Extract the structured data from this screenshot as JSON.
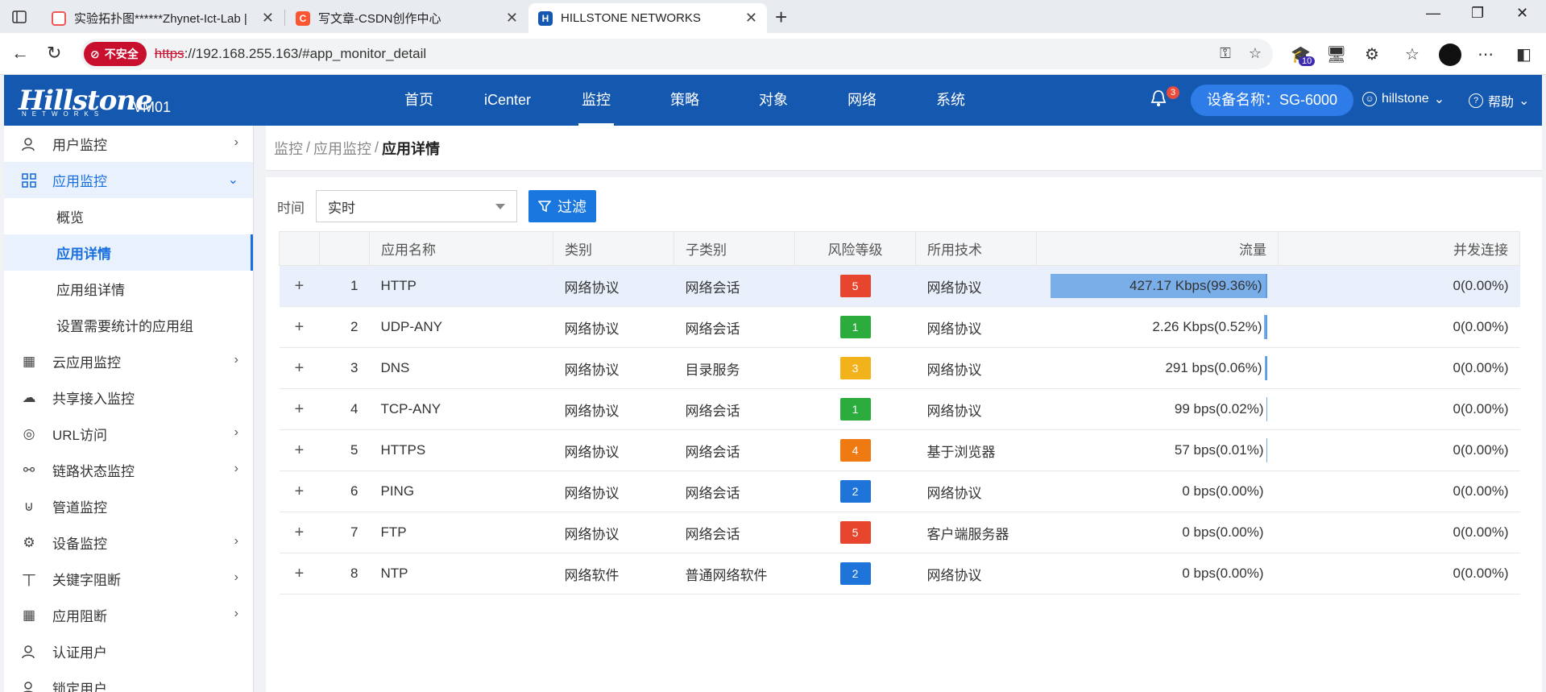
{
  "browser": {
    "tabs": [
      {
        "title": "实验拓扑图******Zhynet-Ict-Lab |",
        "icon": "chrome-icon"
      },
      {
        "title": "写文章-CSDN创作中心",
        "icon": "csdn-icon",
        "icon_letter": "C"
      },
      {
        "title": "HILLSTONE NETWORKS",
        "icon": "hillstone-icon",
        "icon_letter": "H"
      }
    ],
    "insecure_label": "不安全",
    "url_scheme": "https",
    "url_rest": "://192.168.255.163/#app_monitor_detail",
    "ext_badge": "10"
  },
  "header": {
    "logo": "Hillstone",
    "logo_sub": "NETWORKS",
    "device_id": "VM01",
    "nav": [
      "首页",
      "iCenter",
      "监控",
      "策略",
      "对象",
      "网络",
      "系统"
    ],
    "active_nav": "监控",
    "bell_count": "3",
    "device_name": "设备名称：SG-6000",
    "user": "hillstone",
    "help": "帮助"
  },
  "sidebar": {
    "user_monitor": "用户监控",
    "app_monitor": "应用监控",
    "sub": [
      "概览",
      "应用详情",
      "应用组详情",
      "设置需要统计的应用组"
    ],
    "cloud_app": "云应用监控",
    "shared_access": "共享接入监控",
    "url_access": "URL访问",
    "link_status": "链路状态监控",
    "tunnel": "管道监控",
    "device_monitor": "设备监控",
    "keyword_block": "关键字阻断",
    "app_block": "应用阻断",
    "auth_user": "认证用户",
    "bind_user": "锁定用户"
  },
  "breadcrumb": {
    "p1": "监控",
    "p2": "应用监控",
    "current": "应用详情"
  },
  "filter": {
    "time_label": "时间",
    "time_value": "实时",
    "button": "过滤"
  },
  "table": {
    "headers": {
      "name": "应用名称",
      "category": "类别",
      "subcategory": "子类别",
      "risk": "风险等级",
      "tech": "所用技术",
      "flow": "流量",
      "concurrent": "并发连接"
    },
    "rows": [
      {
        "idx": "1",
        "name": "HTTP",
        "category": "网络协议",
        "subcategory": "网络会话",
        "risk": "5",
        "risk_color": "#e8452e",
        "tech": "网络协议",
        "flow": "427.17 Kbps(99.36%)",
        "flow_pct": 99.36,
        "concurrent": "0(0.00%)"
      },
      {
        "idx": "2",
        "name": "UDP-ANY",
        "category": "网络协议",
        "subcategory": "网络会话",
        "risk": "1",
        "risk_color": "#2bac3c",
        "tech": "网络协议",
        "flow": "2.26 Kbps(0.52%)",
        "flow_pct": 0.52,
        "concurrent": "0(0.00%)"
      },
      {
        "idx": "3",
        "name": "DNS",
        "category": "网络协议",
        "subcategory": "目录服务",
        "risk": "3",
        "risk_color": "#f2b21c",
        "tech": "网络协议",
        "flow": "291 bps(0.06%)",
        "flow_pct": 0.06,
        "concurrent": "0(0.00%)"
      },
      {
        "idx": "4",
        "name": "TCP-ANY",
        "category": "网络协议",
        "subcategory": "网络会话",
        "risk": "1",
        "risk_color": "#2bac3c",
        "tech": "网络协议",
        "flow": "99 bps(0.02%)",
        "flow_pct": 0.02,
        "concurrent": "0(0.00%)"
      },
      {
        "idx": "5",
        "name": "HTTPS",
        "category": "网络协议",
        "subcategory": "网络会话",
        "risk": "4",
        "risk_color": "#f07a12",
        "tech": "基于浏览器",
        "flow": "57 bps(0.01%)",
        "flow_pct": 0.01,
        "concurrent": "0(0.00%)"
      },
      {
        "idx": "6",
        "name": "PING",
        "category": "网络协议",
        "subcategory": "网络会话",
        "risk": "2",
        "risk_color": "#1f74d9",
        "tech": "网络协议",
        "flow": "0 bps(0.00%)",
        "flow_pct": 0,
        "concurrent": "0(0.00%)"
      },
      {
        "idx": "7",
        "name": "FTP",
        "category": "网络协议",
        "subcategory": "网络会话",
        "risk": "5",
        "risk_color": "#e8452e",
        "tech": "客户端服务器",
        "flow": "0 bps(0.00%)",
        "flow_pct": 0,
        "concurrent": "0(0.00%)"
      },
      {
        "idx": "8",
        "name": "NTP",
        "category": "网络软件",
        "subcategory": "普通网络软件",
        "risk": "2",
        "risk_color": "#1f74d9",
        "tech": "网络协议",
        "flow": "0 bps(0.00%)",
        "flow_pct": 0,
        "concurrent": "0(0.00%)"
      }
    ]
  }
}
